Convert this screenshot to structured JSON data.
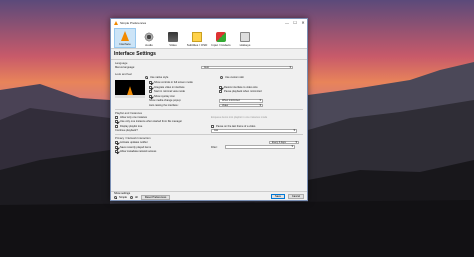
{
  "window": {
    "title": "Simple Preferences",
    "controls": {
      "minimize": "—",
      "maximize": "☐",
      "close": "✕"
    }
  },
  "toolbar": [
    {
      "label": "Interface",
      "icon": "interface-icon",
      "active": true
    },
    {
      "label": "Audio",
      "icon": "audio-icon"
    },
    {
      "label": "Video",
      "icon": "video-icon"
    },
    {
      "label": "Subtitles / OSD",
      "icon": "subtitles-icon"
    },
    {
      "label": "Input / Codecs",
      "icon": "input-codecs-icon"
    },
    {
      "label": "Hotkeys",
      "icon": "hotkeys-icon"
    }
  ],
  "section_title": "Interface Settings",
  "language": {
    "group": "Language",
    "label": "Menus language:",
    "value": "Auto"
  },
  "look": {
    "group": "Look and feel",
    "native_style": "Use native style",
    "custom_skin": "Use custom skin",
    "options_left": [
      {
        "label": "Show controls in full screen mode",
        "checked": true
      },
      {
        "label": "Integrate video in interface",
        "checked": true
      },
      {
        "label": "Start in minimal view mode",
        "checked": false
      },
      {
        "label": "Show systray icon",
        "checked": true
      }
    ],
    "options_right": [
      {
        "label": "Resize interface to video size",
        "checked": true
      },
      {
        "label": "Pause playback when minimized",
        "checked": false
      }
    ],
    "show_media_change": "Show media change popup:",
    "show_media_change_value": "When minimized",
    "auto_raise": "Auto raising the interface:",
    "auto_raise_value": "Video"
  },
  "playlist": {
    "group": "Playlist and Instances",
    "items": [
      {
        "label": "Allow only one instance",
        "checked": false
      },
      {
        "label": "Use only one instance when started from file manager",
        "checked": true
      },
      {
        "label": "Display playlist tree",
        "checked": false
      }
    ],
    "hint": "Enqueue items into playlist in one instance mode",
    "pause_last_frame": "Pause on the last frame of a video",
    "continue_playback": "Continue playback?",
    "continue_value": "Ask"
  },
  "privacy": {
    "group": "Privacy / Network Interaction",
    "items": [
      {
        "label": "Activate updates notifier",
        "checked": true
      },
      {
        "label": "Save recently played items",
        "checked": true
      },
      {
        "label": "Allow metadata network access",
        "checked": true
      }
    ],
    "every": "Every 3 days",
    "filter_label": "Filter:"
  },
  "show_settings": {
    "label": "Show settings",
    "simple": "Simple",
    "all": "All"
  },
  "buttons": {
    "reset": "Reset Preferences",
    "save": "Save",
    "cancel": "Cancel"
  }
}
